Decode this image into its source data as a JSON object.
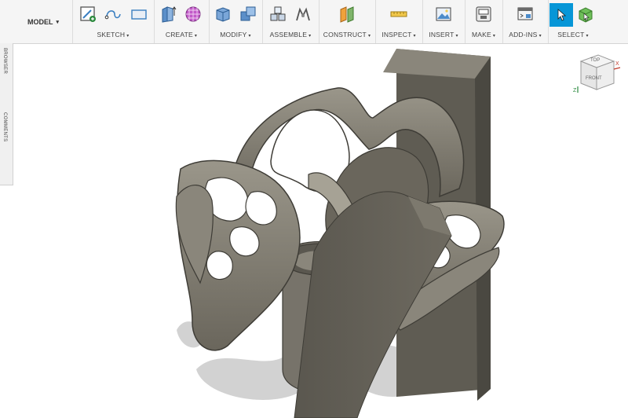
{
  "workspace": {
    "label": "MODEL"
  },
  "toolbar": {
    "sketch": {
      "label": "SKETCH"
    },
    "create": {
      "label": "CREATE"
    },
    "modify": {
      "label": "MODIFY"
    },
    "assemble": {
      "label": "ASSEMBLE"
    },
    "construct": {
      "label": "CONSTRUCT"
    },
    "inspect": {
      "label": "INSPECT"
    },
    "insert": {
      "label": "INSERT"
    },
    "make": {
      "label": "MAKE"
    },
    "addins": {
      "label": "ADD-INS"
    },
    "select": {
      "label": "SELECT"
    },
    "caret": "▾"
  },
  "side_panel": {
    "browser": "BROWSER",
    "comments": "COMMENTS"
  },
  "viewcube": {
    "top": "TOP",
    "front": "FRONT",
    "axis_x": "X",
    "axis_z": "Z"
  },
  "colors": {
    "accent": "#0696d7",
    "model": "#6f6b60",
    "model_dark": "#4f4c44",
    "model_light": "#9a968a"
  }
}
